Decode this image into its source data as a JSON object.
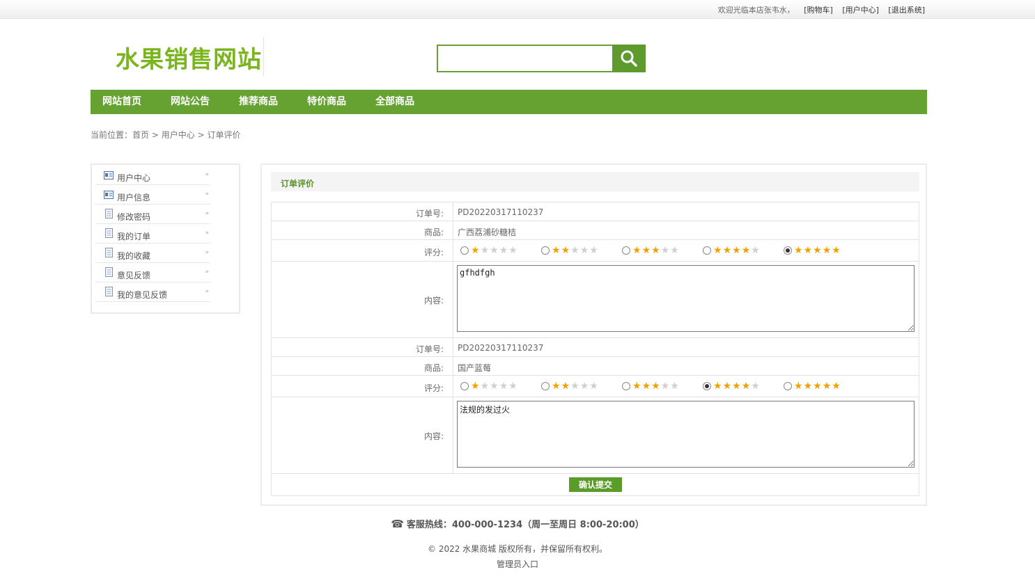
{
  "topbar": {
    "welcome": "欢迎光临本店张韦水，",
    "cart": "[购物车]",
    "user_center": "[用户中心]",
    "logout": "[退出系统]"
  },
  "logo": "水果销售网站",
  "search": {
    "value": "",
    "icon": "search-icon"
  },
  "nav": [
    "网站首页",
    "网站公告",
    "推荐商品",
    "特价商品",
    "全部商品"
  ],
  "breadcrumb": {
    "prefix": "当前位置：",
    "home": "首页",
    "sep": ">",
    "user_center": "用户中心",
    "current": "订单评价"
  },
  "sidebar": {
    "items": [
      {
        "label": "用户中心",
        "icon": "profile-card-icon"
      },
      {
        "label": "用户信息",
        "icon": "profile-card-icon"
      },
      {
        "label": "修改密码",
        "icon": "document-icon"
      },
      {
        "label": "我的订单",
        "icon": "document-icon"
      },
      {
        "label": "我的收藏",
        "icon": "document-icon"
      },
      {
        "label": "意见反馈",
        "icon": "document-icon"
      },
      {
        "label": "我的意见反馈",
        "icon": "document-icon"
      }
    ],
    "arrow": "»"
  },
  "panel": {
    "title": "订单评价",
    "labels": {
      "order_no": "订单号:",
      "product": "商品:",
      "rating": "评分:",
      "content": "内容:"
    },
    "orders": [
      {
        "order_no": "PD20220317110237",
        "product": "广西荔浦砂糖桔",
        "rating": 5,
        "content": "gfhdfgh"
      },
      {
        "order_no": "PD20220317110237",
        "product": "国产蓝莓",
        "rating": 4,
        "content": "法规的发过火"
      }
    ],
    "submit_label": "确认提交"
  },
  "footer": {
    "hotline": "客服热线：400-000-1234（周一至周日 8:00-20:00）",
    "hotline_icon": "phone-icon",
    "copyright": "© 2022 水果商城 版权所有，并保留所有权利。",
    "admin_link": "管理员入口"
  },
  "colors": {
    "brand_green": "#66a232",
    "logo_green": "#7ab51d",
    "star_fill": "#f0a000"
  }
}
